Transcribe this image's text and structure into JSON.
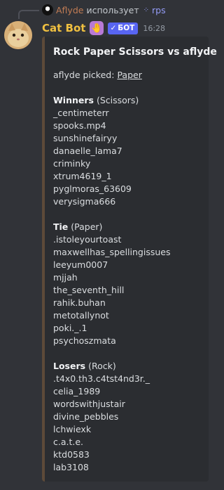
{
  "reply": {
    "author": "Aflyde",
    "text": "использует",
    "command": "rps"
  },
  "message": {
    "username": "Cat Bot",
    "app_icon": "🤚",
    "bot_badge": "БОТ",
    "timestamp": "16:28"
  },
  "embed": {
    "title": "Rock Paper Scissors vs aflyde",
    "picked_label": "aflyde picked:",
    "picked_value": "Paper",
    "sections": [
      {
        "title": "Winners",
        "choice": "(Scissors)",
        "names": [
          "_centimeterr",
          "spooks.mp4",
          "sunshinefairyy",
          "danaelle_lama7",
          "criminky",
          "xtrum4619_1",
          "pyglmoras_63609",
          "verysigma666"
        ]
      },
      {
        "title": "Tie",
        "choice": "(Paper)",
        "names": [
          ".istoleyourtoast",
          "maxwellhas_spellingissues",
          "leeyum0007",
          "mjjah",
          "the_seventh_hill",
          "rahik.buhan",
          "metotallynot",
          "poki._.1",
          "psychoszmata"
        ]
      },
      {
        "title": "Losers",
        "choice": "(Rock)",
        "names": [
          ".t4x0.th3.c4tst4nd3r._",
          "celia_1989",
          "wordswithjustair",
          "divine_pebbles",
          "lchwiexk",
          "c.a.t.e.",
          "ktd0583",
          "lab3108"
        ]
      }
    ]
  },
  "colors": {
    "background": "#313338",
    "embed_background": "#2b2d31",
    "embed_accent": "#5d4a39",
    "username": "#f0c040",
    "reply_author": "#c27c54",
    "bot_badge": "#5865f2",
    "command": "#949cf7"
  }
}
